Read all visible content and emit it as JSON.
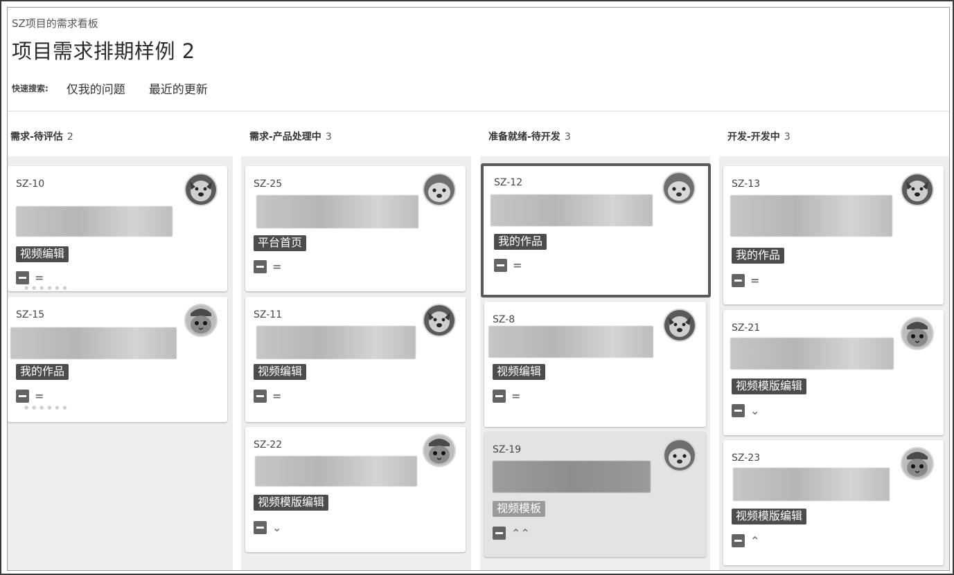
{
  "board": {
    "breadcrumb": "SZ项目的需求看板",
    "title": "项目需求排期样例 2"
  },
  "quick_search": {
    "label": "快速搜索:",
    "links": [
      "仅我的问题",
      "最近的更新"
    ]
  },
  "columns": [
    {
      "title": "需求-待评估",
      "count": "2",
      "cards": [
        {
          "key": "SZ-10",
          "tag": "视频编辑",
          "priority": "=",
          "avatar": "dog"
        },
        {
          "key": "SZ-15",
          "tag": "我的作品",
          "priority": "=",
          "avatar": "cat"
        }
      ]
    },
    {
      "title": "需求-产品处理中",
      "count": "3",
      "cards": [
        {
          "key": "SZ-25",
          "tag": "平台首页",
          "priority": "=",
          "avatar": "dog"
        },
        {
          "key": "SZ-11",
          "tag": "视频编辑",
          "priority": "=",
          "avatar": "dog"
        },
        {
          "key": "SZ-22",
          "tag": "视频模版编辑",
          "priority": "⌄",
          "avatar": "cat"
        }
      ]
    },
    {
      "title": "准备就绪-待开发",
      "count": "3",
      "cards": [
        {
          "key": "SZ-12",
          "tag": "我的作品",
          "priority": "=",
          "avatar": "dog"
        },
        {
          "key": "SZ-8",
          "tag": "视频编辑",
          "priority": "=",
          "avatar": "dog"
        },
        {
          "key": "SZ-19",
          "tag": "视频模板",
          "priority": "⌃⌃",
          "avatar": "dog"
        }
      ]
    },
    {
      "title": "开发-开发中",
      "count": "3",
      "cards": [
        {
          "key": "SZ-13",
          "tag": "我的作品",
          "priority": "=",
          "avatar": "dog"
        },
        {
          "key": "SZ-21",
          "tag": "视频模版编辑",
          "priority": "⌄",
          "avatar": "cat"
        },
        {
          "key": "SZ-23",
          "tag": "视频模版编辑",
          "priority": "⌃",
          "avatar": "cat"
        }
      ]
    }
  ],
  "icons": {
    "issue_type": "story-minus-icon",
    "avatar_dog": "dog-avatar-icon",
    "avatar_cat": "cat-avatar-icon"
  },
  "colors": {
    "tag_bg": "#4c4c4c",
    "column_bg": "#eeeeee",
    "focus_border": "#5a5a5a"
  }
}
